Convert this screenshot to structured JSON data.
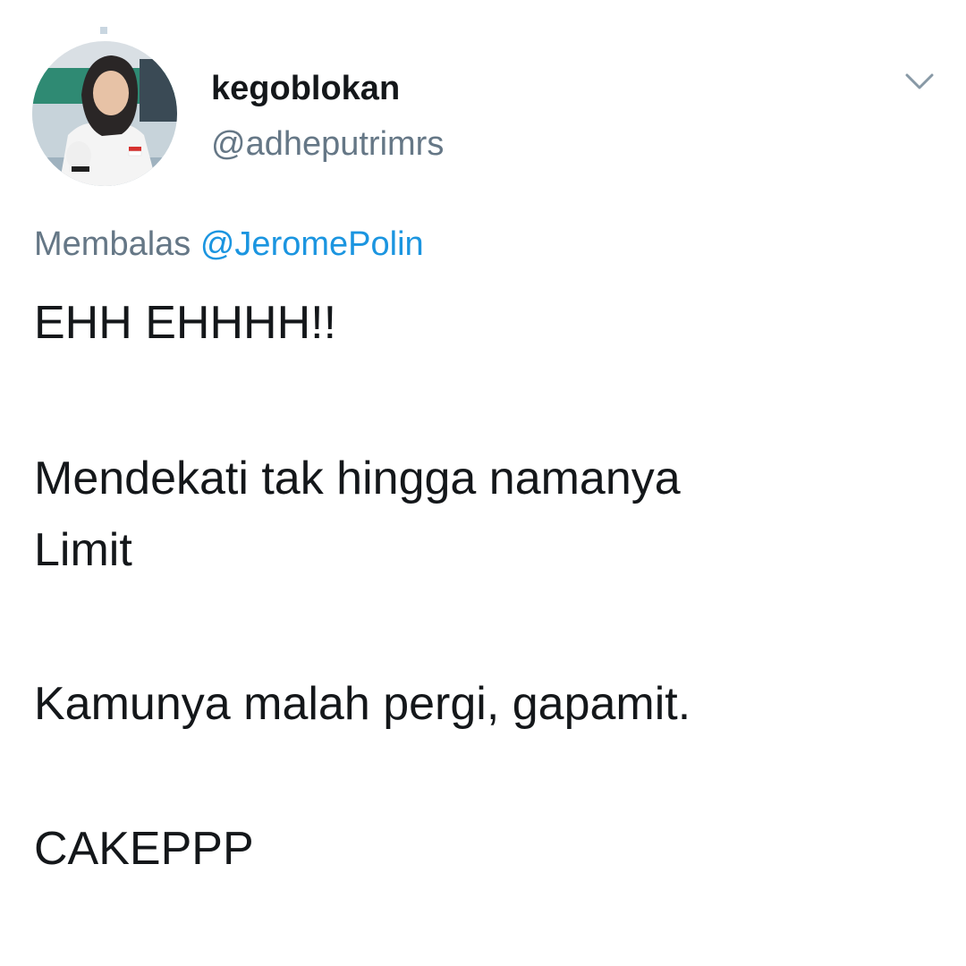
{
  "author": {
    "display_name": "kegoblokan",
    "handle": "@adheputrimrs",
    "avatar_icon": "profile-photo"
  },
  "reply": {
    "prefix": "Membalas",
    "mention": "@JeromePolin"
  },
  "tweet": {
    "lines": [
      "EHH EHHHH!!",
      "Mendekati tak hingga namanya",
      "Limit",
      "Kamunya malah pergi, gapamit.",
      "CAKEPPP"
    ]
  },
  "menu": {
    "icon": "chevron-down-icon"
  },
  "colors": {
    "text": "#14171a",
    "secondary": "#657786",
    "link": "#1b95e0"
  }
}
